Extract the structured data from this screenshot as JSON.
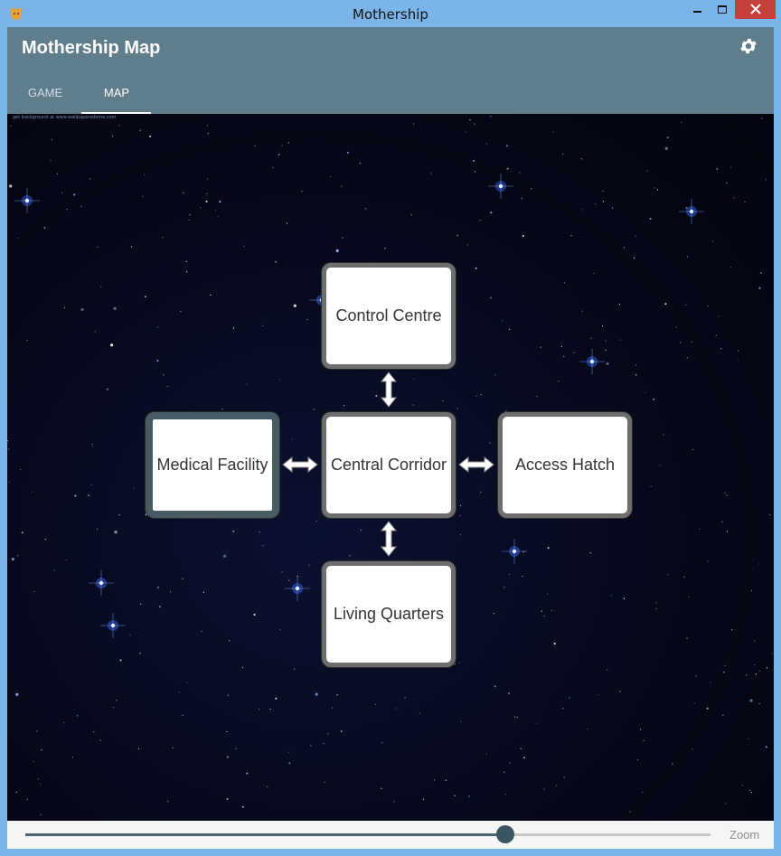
{
  "window": {
    "title": "Mothership",
    "app_icon": "hamster-icon"
  },
  "toolbar": {
    "title": "Mothership Map",
    "settings_icon": "gear-icon"
  },
  "tabs": [
    {
      "label": "GAME",
      "selected": false
    },
    {
      "label": "MAP",
      "selected": true
    }
  ],
  "map": {
    "background_credit": "get background at www.wallpapersdome.com",
    "rooms": {
      "control": "Control Centre",
      "medical": "Medical Facility",
      "central": "Central Corridor",
      "access": "Access Hatch",
      "living": "Living Quarters"
    },
    "current_room": "Medical Facility"
  },
  "zoom": {
    "label": "Zoom",
    "value_fraction": 0.7
  },
  "colors": {
    "toolbar": "#607d8b",
    "accent": "#3c5562",
    "titlebar": "#7ab4e8",
    "close_button": "#c7413c"
  }
}
